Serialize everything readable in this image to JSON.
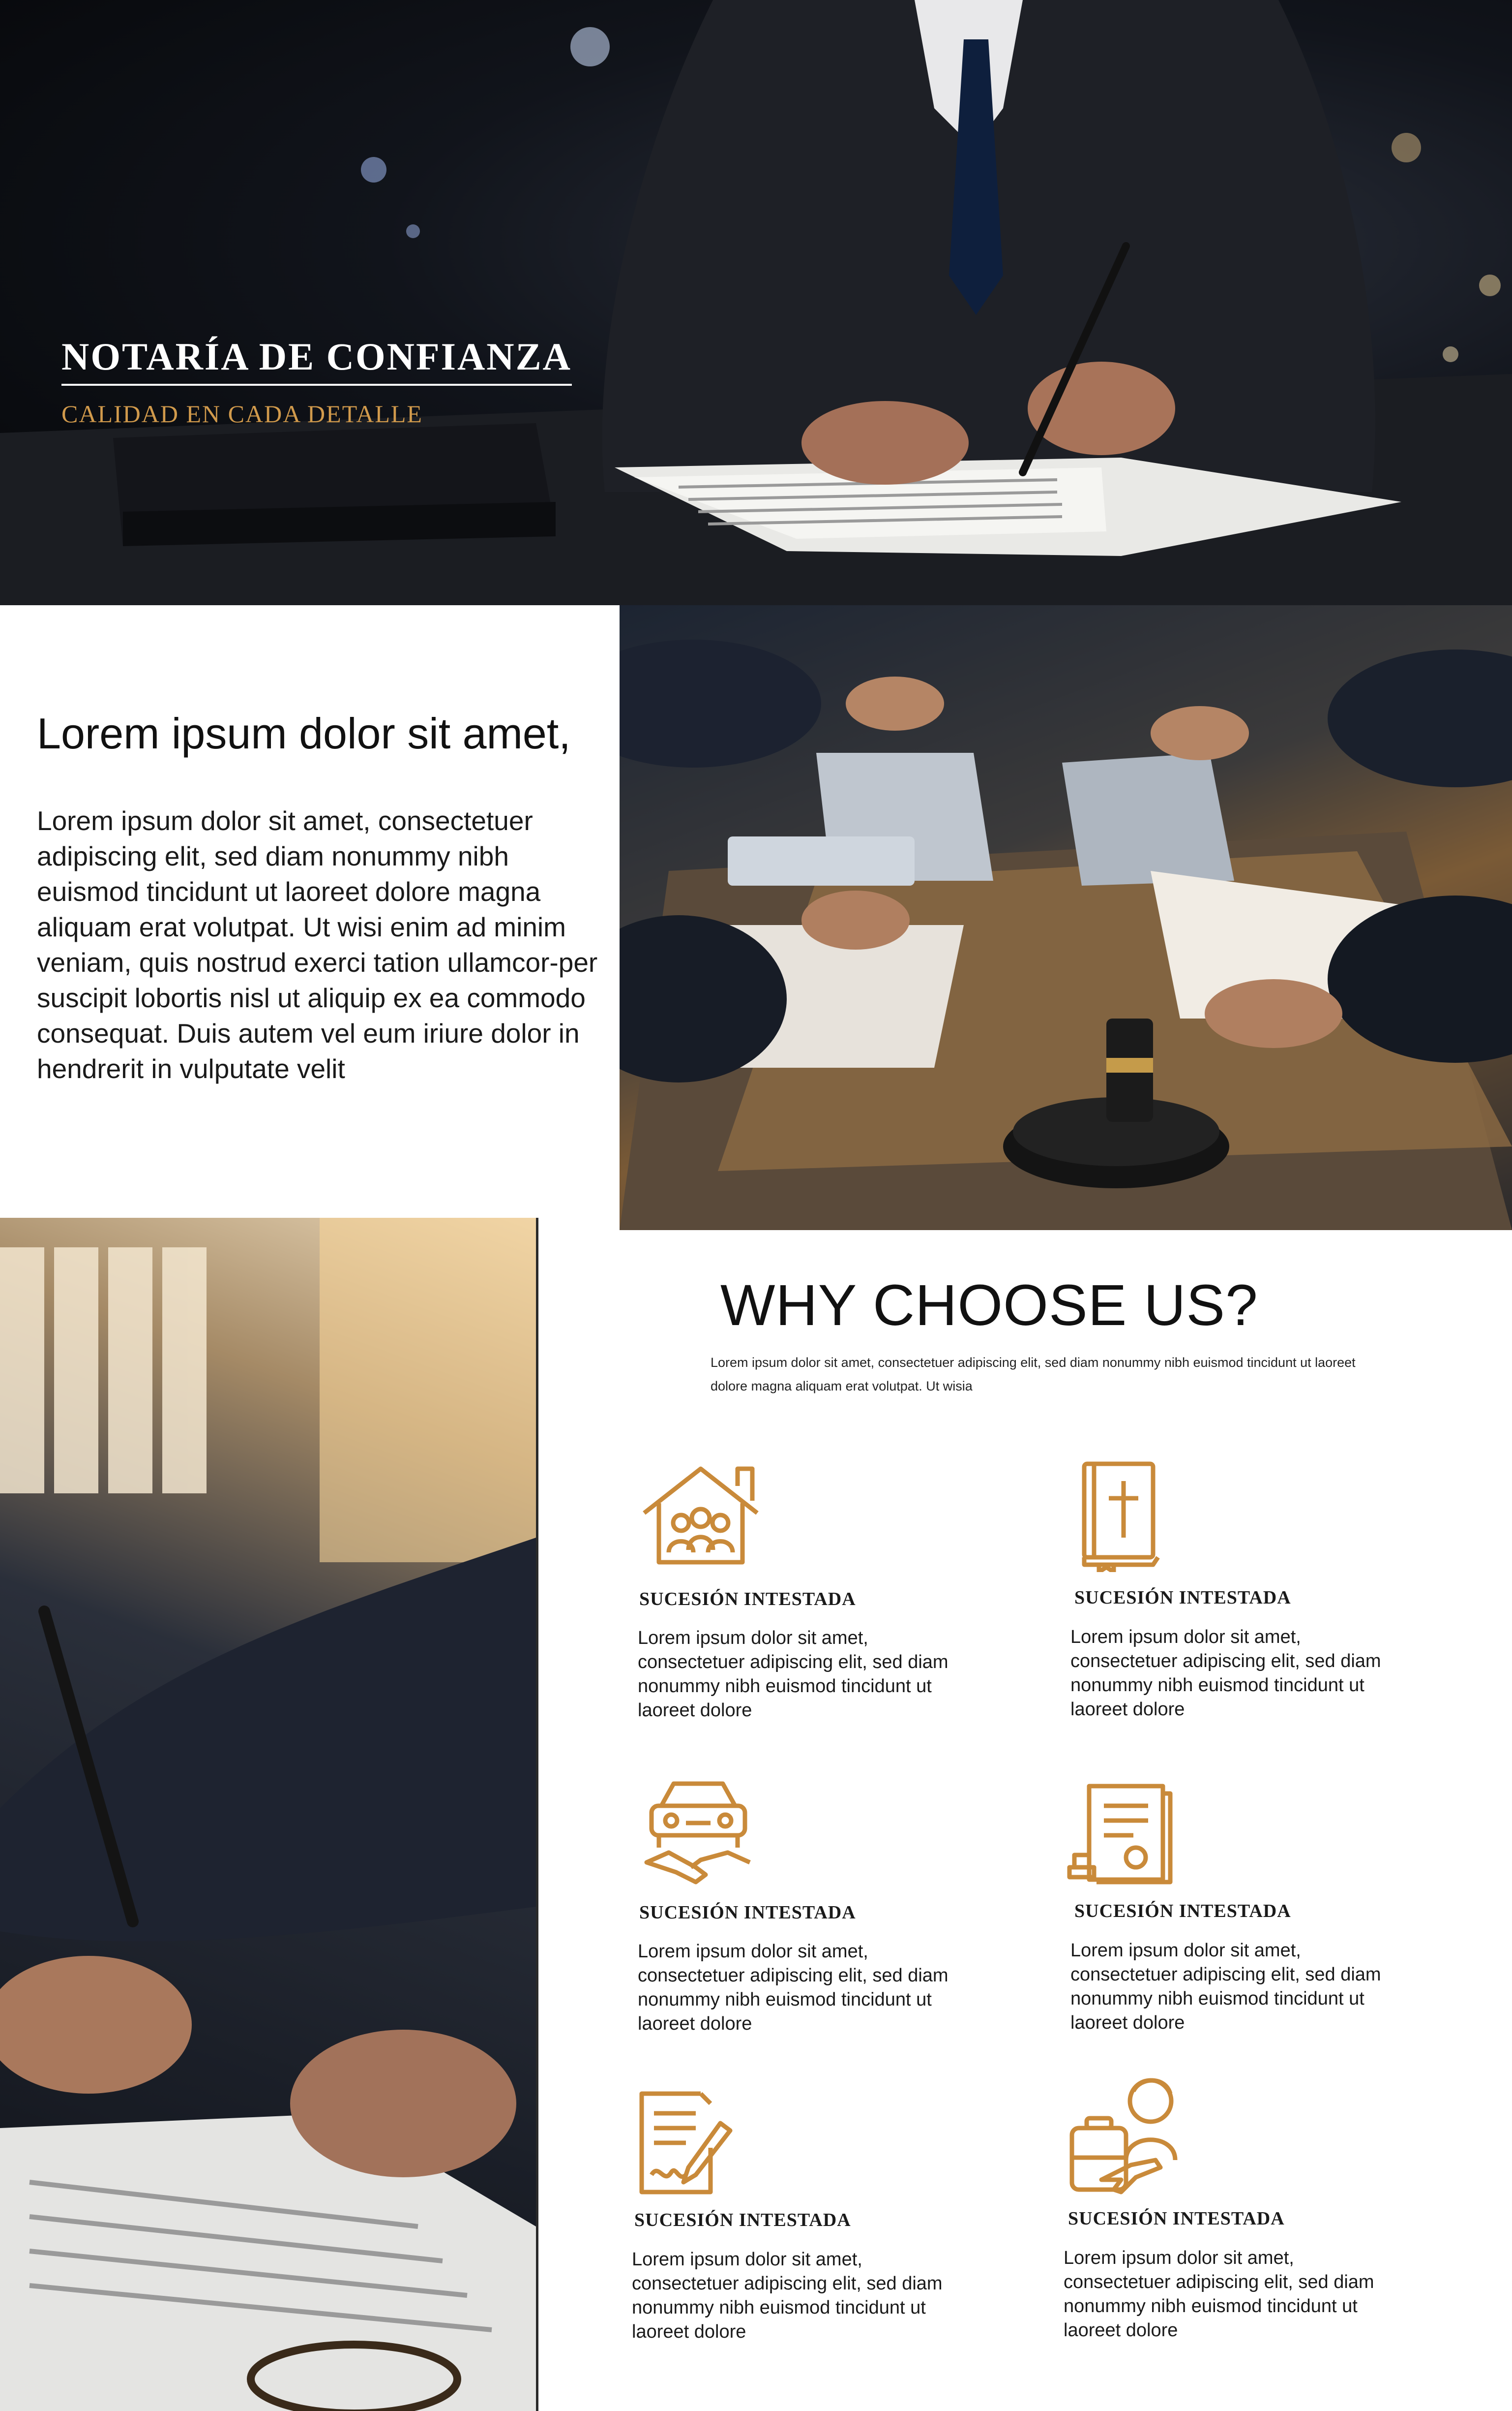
{
  "hero": {
    "title": "NOTARÍA DE CONFIANZA",
    "subtitle": "CALIDAD EN CADA DETALLE"
  },
  "intro": {
    "heading": "Lorem ipsum dolor sit amet,",
    "body": "Lorem ipsum dolor sit amet, consectetuer adipiscing elit, sed diam nonummy nibh euismod tincidunt ut laoreet dolore magna aliquam erat volutpat. Ut wisi enim ad minim veniam, quis nostrud exerci tation ullamcor-per suscipit lobortis nisl ut aliquip ex ea commodo consequat. Duis autem vel eum iriure dolor in hendrerit in vulputate velit"
  },
  "why": {
    "title": "WHY CHOOSE US?",
    "subtitle": "Lorem ipsum dolor sit amet, consectetuer adipiscing elit, sed diam nonummy nibh euismod tincidunt ut laoreet dolore magna aliquam erat volutpat. Ut wisia"
  },
  "services": [
    {
      "icon": "house-family-icon",
      "title": "SUCESIÓN INTESTADA",
      "text": "Lorem ipsum dolor sit amet, consectetuer adipiscing elit, sed diam nonummy nibh euismod tincidunt ut laoreet dolore"
    },
    {
      "icon": "bible-cross-icon",
      "title": "SUCESIÓN INTESTADA",
      "text": "Lorem ipsum dolor sit amet, consectetuer adipiscing elit, sed diam nonummy nibh euismod tincidunt ut laoreet dolore"
    },
    {
      "icon": "car-handshake-icon",
      "title": "SUCESIÓN INTESTADA",
      "text": "Lorem ipsum dolor sit amet, consectetuer adipiscing elit, sed diam nonummy nibh euismod tincidunt ut laoreet dolore"
    },
    {
      "icon": "stamped-certificate-icon",
      "title": "SUCESIÓN INTESTADA",
      "text": "Lorem ipsum dolor sit amet, consectetuer adipiscing elit, sed diam nonummy nibh euismod tincidunt ut laoreet dolore"
    },
    {
      "icon": "signed-contract-icon",
      "title": "SUCESIÓN INTESTADA",
      "text": "Lorem ipsum dolor sit amet, consectetuer adipiscing elit, sed diam nonummy nibh euismod tincidunt ut laoreet dolore"
    },
    {
      "icon": "child-travel-icon",
      "title": "SUCESIÓN INTESTADA",
      "text": "Lorem ipsum dolor sit amet, consectetuer adipiscing elit, sed diam nonummy nibh euismod tincidunt ut laoreet dolore"
    }
  ],
  "colors": {
    "accent": "#d19a4c",
    "icon": "#c98a3a",
    "text": "#1a1a1a",
    "hero_bg": "#0b0d12"
  }
}
